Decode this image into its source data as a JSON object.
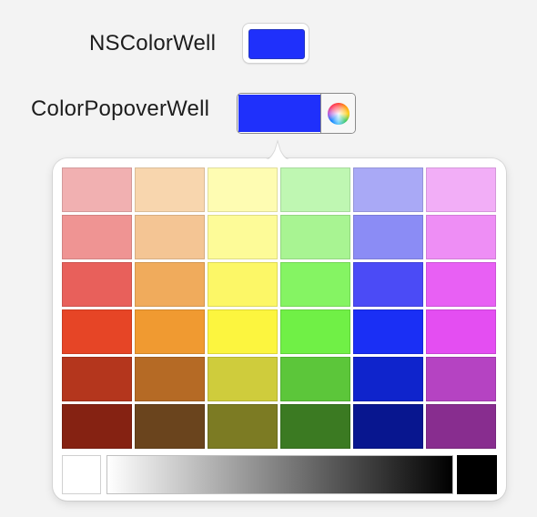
{
  "labels": {
    "nscolorwell": "NSColorWell",
    "colorpopoverwell": "ColorPopoverWell"
  },
  "selected_color": "#1f30fb",
  "popover": {
    "swatches": [
      [
        "#f1b0b1",
        "#f8d6ae",
        "#fefcb2",
        "#bff7b2",
        "#a9a9f6",
        "#f2aef7"
      ],
      [
        "#ef9493",
        "#f4c594",
        "#fdfb98",
        "#a8f492",
        "#8b8cf5",
        "#ee8ef5"
      ],
      [
        "#e8605b",
        "#f0ab5c",
        "#fcf767",
        "#85f463",
        "#4b4bf6",
        "#e860f4"
      ],
      [
        "#e64526",
        "#f09a31",
        "#fcf53f",
        "#70f046",
        "#1a2ff5",
        "#e44ef2"
      ],
      [
        "#b4361d",
        "#b56a25",
        "#cfcc3c",
        "#5cc63a",
        "#0f24cc",
        "#b543c2"
      ],
      [
        "#852212",
        "#6a441d",
        "#7c7b23",
        "#3b7a22",
        "#08168f",
        "#882d8f"
      ]
    ],
    "grayscale": {
      "white": "#ffffff",
      "black": "#000000"
    }
  }
}
